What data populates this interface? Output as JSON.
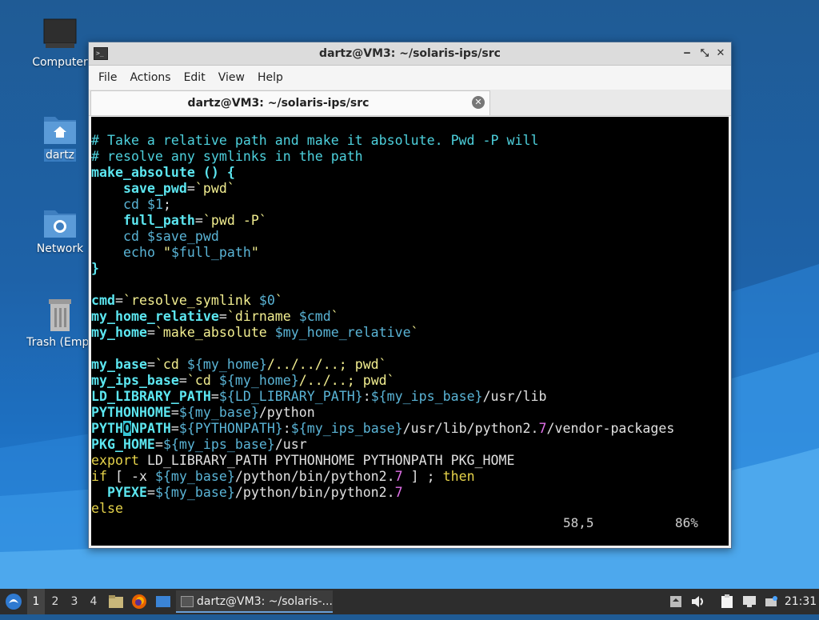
{
  "desktop": {
    "icons": [
      {
        "label": "Computer",
        "icon": "computer-icon"
      },
      {
        "label": "dartz",
        "icon": "home-folder-icon"
      },
      {
        "label": "Network",
        "icon": "network-folder-icon"
      },
      {
        "label": "Trash (Empt",
        "icon": "trash-icon"
      }
    ]
  },
  "window": {
    "title": "dartz@VM3: ~/solaris-ips/src",
    "controls": {
      "minimize": "‒",
      "maximize": "⤡",
      "close": "✕"
    }
  },
  "menu": [
    "File",
    "Actions",
    "Edit",
    "View",
    "Help"
  ],
  "tab": {
    "label": "dartz@VM3: ~/solaris-ips/src",
    "close": "✕"
  },
  "status": {
    "position": "58,5",
    "percent": "86%"
  },
  "taskbar": {
    "workspaces": [
      "1",
      "2",
      "3",
      "4"
    ],
    "active_workspace": "1",
    "task_label": "dartz@VM3: ~/solaris-...",
    "clock": "21:31"
  },
  "colors": {
    "desktop": "#1e62a8",
    "terminal_bg": "#000000",
    "comment": "#4dd0dc",
    "variable": "#5ce6f0",
    "string": "#f2ee90",
    "keyword": "#e6d34a",
    "number": "#e070e8"
  }
}
